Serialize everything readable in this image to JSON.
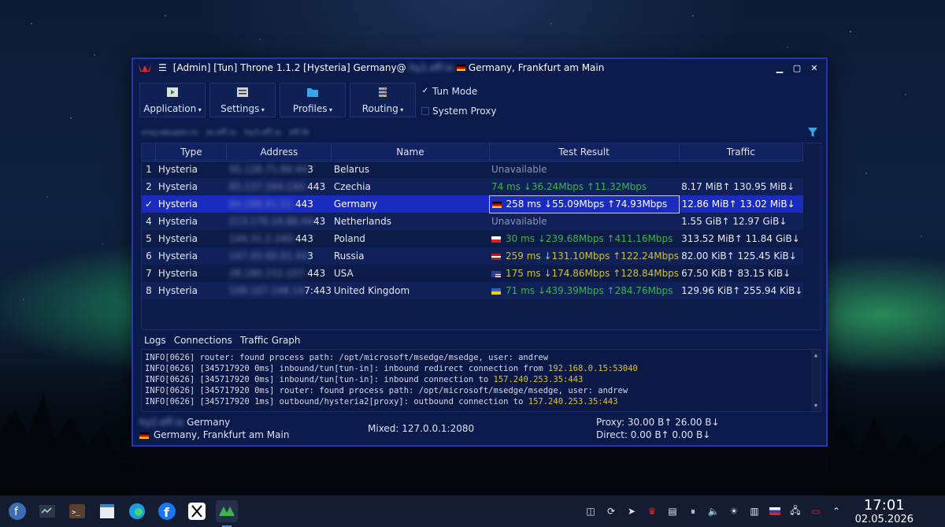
{
  "window": {
    "title_prefix": "[Admin] [Tun] Throne 1.1.2 [Hysteria] Germany@",
    "title_blurred": "hy1.eff.io",
    "title_suffix": "Germany, Frankfurt am Main"
  },
  "toolbar": {
    "buttons": [
      {
        "label": "Application"
      },
      {
        "label": "Settings"
      },
      {
        "label": "Profiles"
      },
      {
        "label": "Routing"
      }
    ],
    "tun_mode": "Tun Mode",
    "system_proxy": "System Proxy"
  },
  "groups": [
    "vray.abupto.ru",
    "ss.eff.io",
    "hy2.eff.io",
    "eff.tk"
  ],
  "table": {
    "headers": [
      "Type",
      "Address",
      "Name",
      "Test Result",
      "Traffic"
    ],
    "rows": [
      {
        "num": "1",
        "type": "Hysteria",
        "addr_blur": "95.128.71.86:44",
        "addr_tail": "3",
        "name": "Belarus",
        "result": "Unavailable",
        "traffic": ""
      },
      {
        "num": "2",
        "type": "Hysteria",
        "addr_blur": "85.137.164.140:",
        "addr_tail": "443",
        "name": "Czechia",
        "result": "74 ms ↓36.24Mbps ↑11.32Mbps",
        "traffic": "8.17 MiB↑ 130.95 MiB↓"
      },
      {
        "num": "✓",
        "type": "Hysteria",
        "addr_blur": "84.188.91.51:",
        "addr_tail": "443",
        "name": "Germany",
        "result": "258 ms ↓55.09Mbps ↑74.93Mbps",
        "traffic": "12.86 MiB↑ 13.02 MiB↓"
      },
      {
        "num": "4",
        "type": "Hysteria",
        "addr_blur": "213.176.16.86:44",
        "addr_tail": "43",
        "name": "Netherlands",
        "result": "Unavailable",
        "traffic": "1.55 GiB↑ 12.97 GiB↓"
      },
      {
        "num": "5",
        "type": "Hysteria",
        "addr_blur": "144.31.2.240:",
        "addr_tail": "443",
        "name": "Poland",
        "result": "30 ms ↓239.68Mbps ↑411.16Mbps",
        "traffic": "313.52 MiB↑ 11.84 GiB↓"
      },
      {
        "num": "6",
        "type": "Hysteria",
        "addr_blur": "147.45.60.61:44",
        "addr_tail": "3",
        "name": "Russia",
        "result": "259 ms ↓131.10Mbps ↑122.24Mbps",
        "traffic": "82.00 KiB↑ 125.45 KiB↓"
      },
      {
        "num": "7",
        "type": "Hysteria",
        "addr_blur": "38.180.152.107:",
        "addr_tail": "443",
        "name": "USA",
        "result": "175 ms ↓174.86Mbps ↑128.84Mbps",
        "traffic": "67.50 KiB↑ 83.15 KiB↓"
      },
      {
        "num": "8",
        "type": "Hysteria",
        "addr_blur": "109.107.148.14",
        "addr_tail": "7:443",
        "name": "United Kingdom",
        "result": "71 ms ↓439.39Mbps ↑284.76Mbps",
        "traffic": "129.96 KiB↑ 255.94 KiB↓"
      }
    ]
  },
  "bottom_tabs": [
    "Logs",
    "Connections",
    "Traffic Graph"
  ],
  "logs": [
    {
      "text": "INFO[0626] router: found process path: /opt/microsoft/msedge/msedge, user: andrew",
      "ip": ""
    },
    {
      "text": "INFO[0626] [345717920 0ms] inbound/tun[tun-in]: inbound redirect connection from ",
      "ip": "192.168.0.15:53040"
    },
    {
      "text": "INFO[0626] [345717920 0ms] inbound/tun[tun-in]: inbound connection to ",
      "ip": "157.240.253.35:443"
    },
    {
      "text": "INFO[0626] [345717920 0ms] router: found process path: /opt/microsoft/msedge/msedge, user: andrew",
      "ip": ""
    },
    {
      "text": "INFO[0626] [345717920 1ms] outbound/hysteria2[proxy]: outbound connection to ",
      "ip": "157.240.253.35:443"
    }
  ],
  "status": {
    "server_blur": "hy2.eff.io",
    "server_name": "Germany",
    "location": "Germany, Frankfurt am Main",
    "mixed": "Mixed: 127.0.0.1:2080",
    "proxy": "Proxy: 30.00 B↑ 26.00 B↓",
    "direct": "Direct: 0.00 B↑ 0.00 B↓"
  },
  "clock": {
    "time": "17:01",
    "date": "02.05.2026"
  },
  "colors": {
    "window_bg": "#0a1a4a",
    "selected_row": "#1a2cc0",
    "good": "#3fb24f",
    "warn": "#c8c040"
  }
}
